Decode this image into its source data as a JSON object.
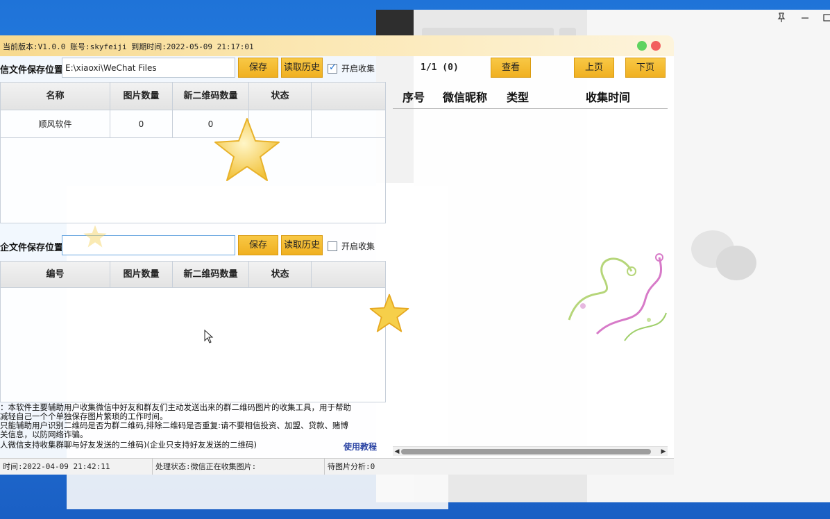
{
  "app": {
    "title": "当前版本:V1.0.0 账号:skyfeiji 到期时间:2022-05-09 21:17:01"
  },
  "top_section": {
    "label": "信文件保存位置",
    "path_value": "E:\\xiaoxi\\WeChat Files",
    "save_btn": "保存",
    "history_btn": "读取历史",
    "collect_label": "开启收集",
    "collect_checked": true,
    "columns": [
      "名称",
      "图片数量",
      "新二维码数量",
      "状态"
    ],
    "rows": [
      {
        "name": "顺风软件",
        "img_count": "0",
        "qr_count": "0",
        "status": ""
      }
    ]
  },
  "bottom_section": {
    "label": "企文件保存位置",
    "path_value": "",
    "save_btn": "保存",
    "history_btn": "读取历史",
    "collect_label": "开启收集",
    "collect_checked": false,
    "columns": [
      "编号",
      "图片数量",
      "新二维码数量",
      "状态"
    ]
  },
  "right_pane": {
    "page_info": "1/1 (0)",
    "view_btn": "查看",
    "prev_btn": "上页",
    "next_btn": "下页",
    "columns": [
      "序号",
      "微信昵称",
      "类型",
      "收集时间"
    ]
  },
  "description": {
    "line1": "：本软件主要辅助用户收集微信中好友和群友们主动发送出来的群二维码图片的收集工具，用于帮助",
    "line2": "减轻自己一个个单独保存图片繁琐的工作时间。",
    "line3": "只能辅助用户识别二维码是否为群二维码,排除二维码是否重复:请不要相信投资、加盟、贷款、赌博",
    "line4": "关信息，以防网络诈骗。",
    "line5": "人微信支持收集群聊与好友发送的二维码)(企业只支持好友发送的二维码)",
    "tutorial_link": "使用教程"
  },
  "statusbar": {
    "time": "时间:2022-04-09 21:42:11",
    "state": "处理状态:微信正在收集图片:",
    "pending": "待图片分析:0"
  },
  "icons": {
    "pin": "pin-icon",
    "minimize": "minimize-icon",
    "maximize": "maximize-icon"
  },
  "colors": {
    "button": "#f0b021",
    "title_gradient_start": "#f7d98e",
    "link": "#2a43a3",
    "desktop": "#1f73d8"
  }
}
